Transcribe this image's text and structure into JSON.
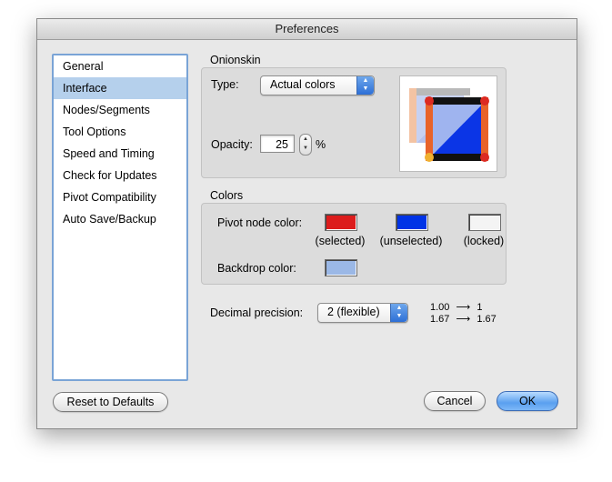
{
  "window": {
    "title": "Preferences"
  },
  "sidebar": {
    "items": [
      {
        "label": "General"
      },
      {
        "label": "Interface",
        "selected": true
      },
      {
        "label": "Nodes/Segments"
      },
      {
        "label": "Tool Options"
      },
      {
        "label": "Speed and Timing"
      },
      {
        "label": "Check for Updates"
      },
      {
        "label": "Pivot Compatibility"
      },
      {
        "label": "Auto Save/Backup"
      }
    ]
  },
  "onionskin": {
    "group_label": "Onionskin",
    "type_label": "Type:",
    "type_value": "Actual colors",
    "opacity_label": "Opacity:",
    "opacity_value": "25",
    "opacity_unit": "%",
    "preview_icon": "onionskin-preview-icon"
  },
  "colors": {
    "group_label": "Colors",
    "pivot_node_label": "Pivot node color:",
    "swatches": [
      {
        "caption": "(selected)",
        "color": "#dc1c1c"
      },
      {
        "caption": "(unselected)",
        "color": "#0033e6"
      },
      {
        "caption": "(locked)",
        "color": "#f4f4f4"
      }
    ],
    "backdrop_label": "Backdrop color:",
    "backdrop_color": "#9bb8e6"
  },
  "precision": {
    "label": "Decimal precision:",
    "value": "2 (flexible)",
    "examples": [
      {
        "from": "1.00",
        "to": "1"
      },
      {
        "from": "1.67",
        "to": "1.67"
      }
    ]
  },
  "buttons": {
    "reset": "Reset to Defaults",
    "cancel": "Cancel",
    "ok": "OK"
  }
}
